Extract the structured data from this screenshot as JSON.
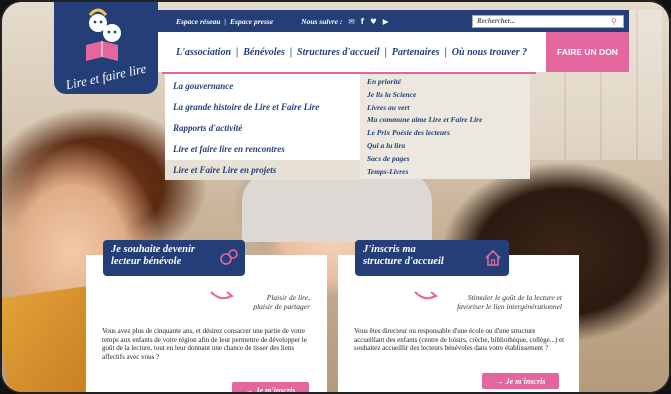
{
  "logo": {
    "text": "Lire et faire lire"
  },
  "topbar": {
    "links": [
      "Espace réseau",
      "Espace presse"
    ],
    "follow_label": "Nous suivre :",
    "social_icons": [
      "mail-icon",
      "facebook-icon",
      "twitter-icon",
      "youtube-icon"
    ],
    "search_placeholder": "Rechercher..."
  },
  "nav": {
    "items": [
      "L'association",
      "Bénévoles",
      "Structures d'accueil",
      "Partenaires",
      "Où nous trouver ?"
    ],
    "donate": "FAIRE UN DON"
  },
  "dropdown": {
    "left": [
      "La gouvernance",
      "La grande histoire de Lire et Faire Lire",
      "Rapports d'activité",
      "Lire et faire lire en rencontres",
      "Lire et Faire Lire en projets"
    ],
    "right": [
      "En priorité",
      "Je lis la Science",
      "Livres au vert",
      "Ma commune aime Lire et Faire Lire",
      "Le Prix Poésie des lecteurs",
      "Qui a lu lira",
      "Sacs de pages",
      "Temps-Livres"
    ]
  },
  "cards": [
    {
      "title_line1": "Je souhaite devenir",
      "title_line2": "lecteur bénévole",
      "tagline_line1": "Plaisir de lire,",
      "tagline_line2": "plaisir de partager",
      "body": "Vous avez plus de cinquante ans, et désirez consacrer une partie de votre temps aux enfants de votre région afin de leur permettre de développer le goût de la lecture, tout en leur donnant une chance de tisser des liens affectifs avec vous ?",
      "cta": "→ Je m'inscris"
    },
    {
      "title_line1": "J'inscris ma",
      "title_line2": "structure d'accueil",
      "tagline_line1": "Stimuler le goût de la lecture et",
      "tagline_line2": "favoriser le lien intergénérationnel",
      "body": "Vous êtes directeur ou responsable d'une école ou d'une structure accueillant des enfants (centre de loisirs, crèche, bibliothèque, collège...) et souhaitez accueillir des lecteurs bénévoles dans votre établissement ?",
      "cta": "→ Je m'inscris"
    }
  ],
  "colors": {
    "navy": "#243f78",
    "pink": "#e4669f"
  }
}
